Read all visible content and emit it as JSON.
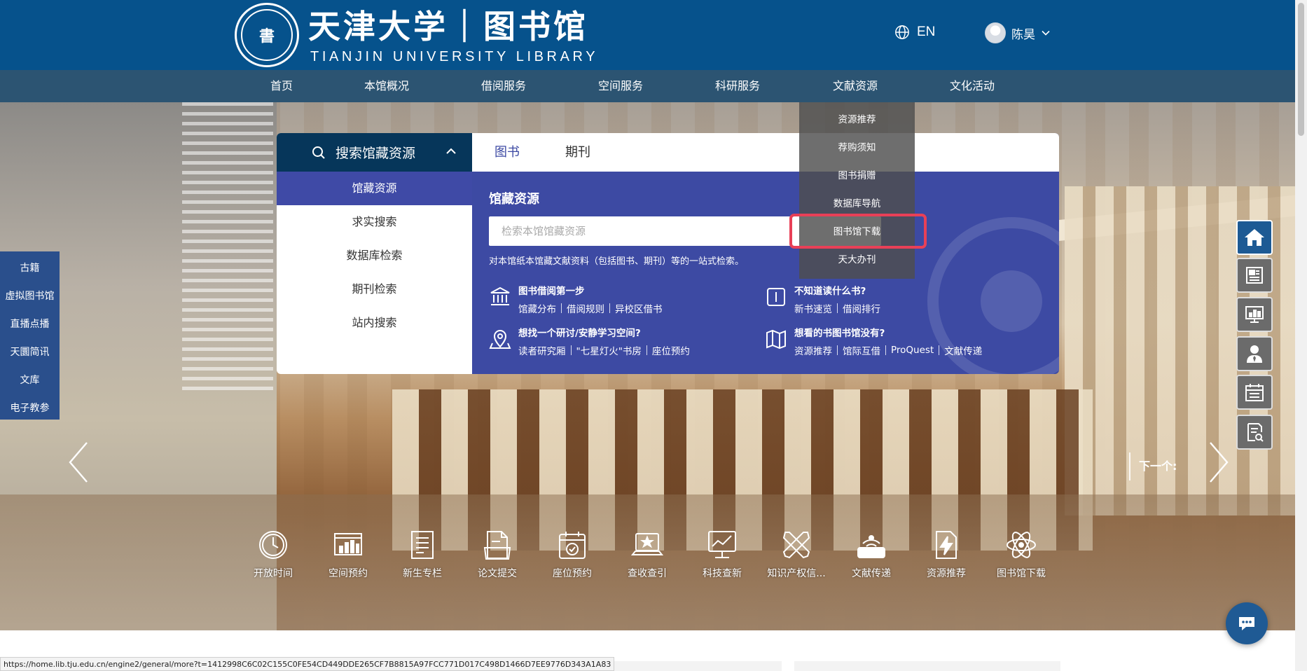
{
  "header": {
    "logo_seal_text": "書",
    "logo_cn": "天津大学｜图书馆",
    "logo_en": "TIANJIN UNIVERSITY LIBRARY",
    "lang": "EN",
    "user_name": "陈昊"
  },
  "nav": {
    "items": [
      "首页",
      "本馆概况",
      "借阅服务",
      "空间服务",
      "科研服务",
      "文献资源",
      "文化活动"
    ]
  },
  "dropdown": {
    "items": [
      "资源推荐",
      "荐购须知",
      "图书捐赠",
      "数据库导航",
      "图书馆下载",
      "天大办刊"
    ]
  },
  "search_panel": {
    "header": "搜索馆藏资源",
    "menu": [
      "馆藏资源",
      "求实搜索",
      "数据库检索",
      "期刊检索",
      "站内搜索"
    ],
    "tabs": [
      "图书",
      "期刊"
    ],
    "title": "馆藏资源",
    "placeholder": "检索本馆馆藏资源",
    "description": "对本馆纸本馆藏文献资料（包括图书、期刊）等的一站式检索。",
    "blocks": [
      {
        "title": "图书借阅第一步",
        "links": [
          "馆藏分布",
          "借阅规则",
          "异校区借书"
        ]
      },
      {
        "title": "不知道读什么书?",
        "links": [
          "新书速览",
          "借阅排行"
        ]
      },
      {
        "title": "想找一个研讨/安静学习空间?",
        "links": [
          "读者研究厢",
          "\"七星灯火\"书房",
          "座位预约"
        ]
      },
      {
        "title": "想看的书图书馆没有?",
        "links": [
          "资源推荐",
          "馆际互借",
          "ProQuest",
          "文献传递"
        ]
      }
    ]
  },
  "left_links": [
    "古籍",
    "虚拟图书馆",
    "直播点播",
    "天圜简讯",
    "文库",
    "电子教参"
  ],
  "carousel": {
    "next_label": "下一个:"
  },
  "services": [
    "开放时间",
    "空间预约",
    "新生专栏",
    "论文提交",
    "座位预约",
    "查收查引",
    "科技查新",
    "知识产权信...",
    "文献传递",
    "资源推荐",
    "图书馆下载"
  ],
  "right_tools": [
    "home-icon",
    "news-icon",
    "chart-icon",
    "librarian-icon",
    "calendar-icon",
    "search-doc-icon"
  ],
  "status_url": "https://home.lib.tju.edu.cn/engine2/general/more?t=1412998C6C02C155C0FE54CD449DDE265CF7B8815A97FCC771D017C498D1466D7EE9776D343A1A83",
  "colors": {
    "header_bg": "#06528c",
    "nav_bg": "#2c5472",
    "panel_blue": "#3d4aa3",
    "panel_head": "#06365a",
    "highlight": "#e84057"
  }
}
